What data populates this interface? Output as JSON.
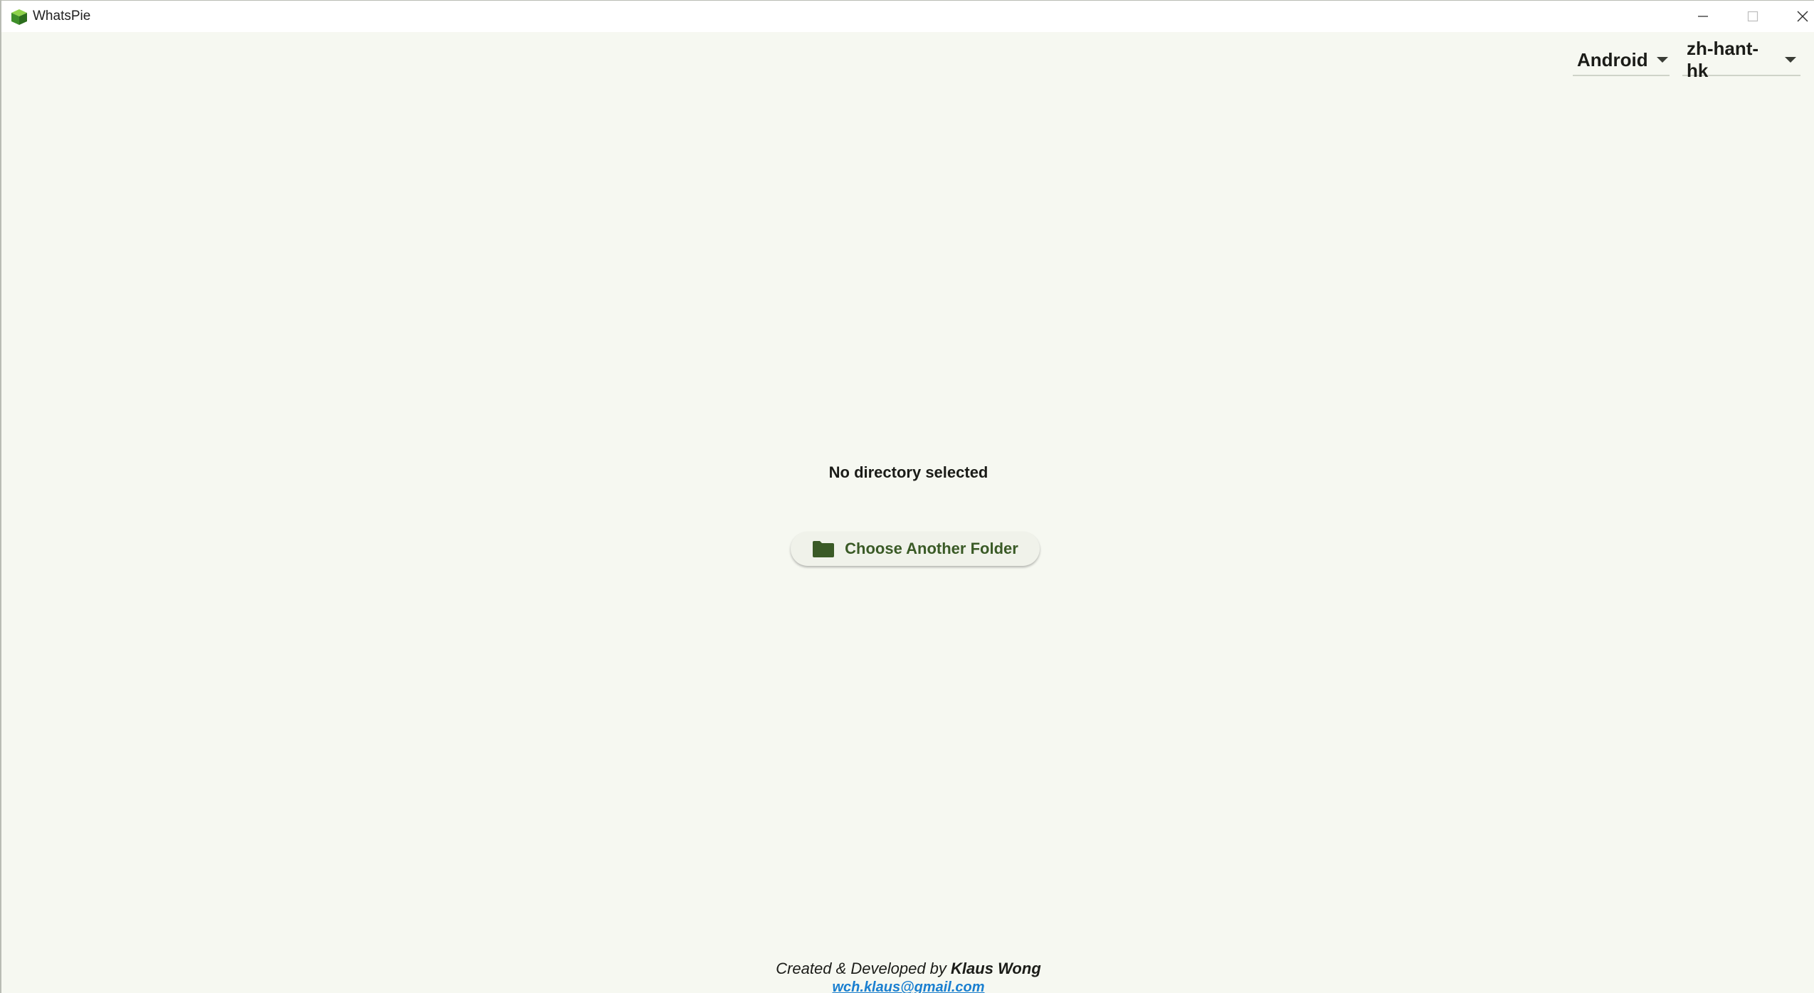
{
  "window": {
    "title": "WhatsPie",
    "app_icon": "green-cube-icon",
    "controls": [
      "minimize-icon",
      "maximize-icon",
      "close-icon"
    ]
  },
  "toolbar": {
    "platform_selected": "Android",
    "locale_selected": "zh-hant-hk"
  },
  "main": {
    "status": "No directory selected",
    "choose_button_label": "Choose Another Folder",
    "choose_button_icon": "folder-icon"
  },
  "footer": {
    "credit_prefix": "Created & Developed by",
    "author": "Klaus Wong",
    "email": "wch.klaus@gmail.com"
  },
  "colors": {
    "background": "#f6f8f1",
    "accent_green": "#3a5a26",
    "link_blue": "#1a7fd0"
  }
}
